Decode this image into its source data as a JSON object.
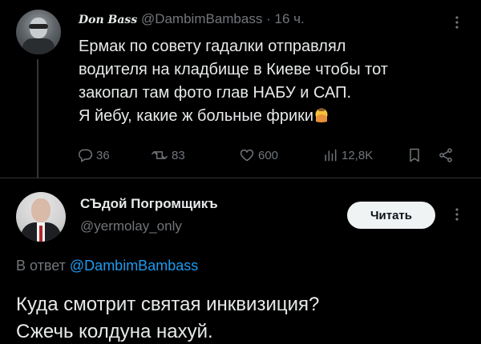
{
  "tweet1": {
    "display_name": "Don Bass",
    "handle": "@DambimBambass",
    "separator": "·",
    "time": "16 ч.",
    "text_lines": [
      "Ермак по совету гадалки отправлял",
      "водителя на кладбище в Киеве чтобы тот",
      "закопал там фото глав НАБУ и САП.",
      "Я йебу, какие ж больные фрики"
    ],
    "emoji": "face-palm-emoji",
    "actions": {
      "replies": "36",
      "reposts": "83",
      "likes": "600",
      "views": "12,8K"
    }
  },
  "tweet2": {
    "display_name": "СЪдой Погромщикъ",
    "handle": "@yermolay_only",
    "follow_label": "Читать",
    "reply_prefix": "В ответ",
    "reply_to": "@DambimBambass",
    "text_lines": [
      "Куда смотрит святая инквизиция?",
      "Сжечь колдуна нахуй."
    ]
  },
  "icons": {
    "reply": "reply-icon",
    "repost": "repost-icon",
    "like": "heart-icon",
    "views": "views-icon",
    "bookmark": "bookmark-icon",
    "share": "share-icon",
    "more": "more-icon"
  },
  "colors": {
    "background": "#000000",
    "text": "#e7e9ea",
    "muted": "#71767b",
    "link": "#1d9bf0",
    "divider": "#2f3336",
    "button_bg": "#eff3f4"
  }
}
